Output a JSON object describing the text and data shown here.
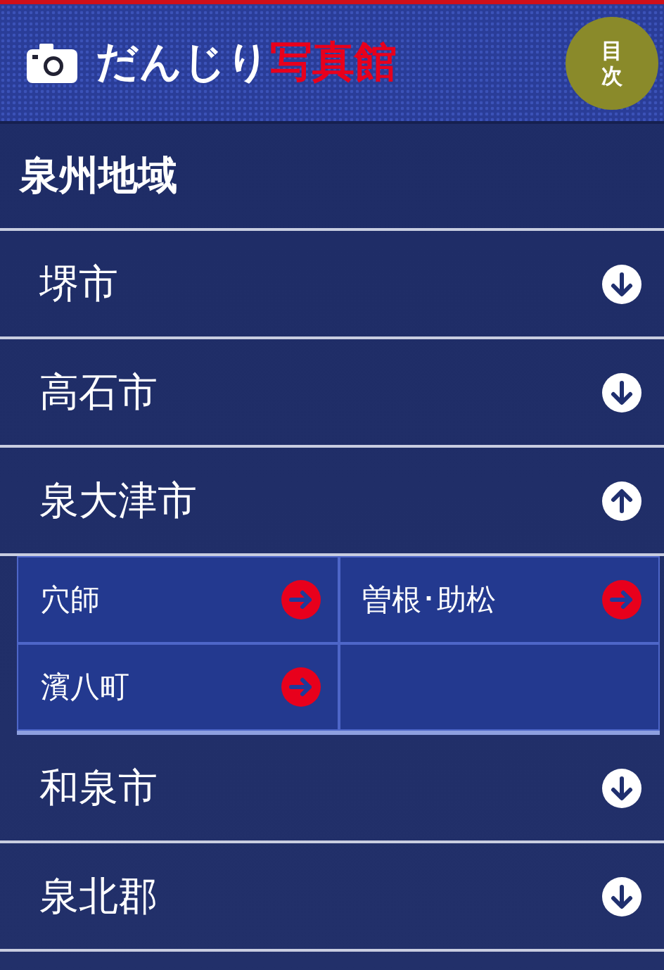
{
  "header": {
    "title_part1": "だんじり",
    "title_part2": "写真館",
    "menu_button": {
      "line1": "目",
      "line2": "次"
    }
  },
  "section_title": "泉州地域",
  "cities": [
    {
      "name": "堺市",
      "expanded": false
    },
    {
      "name": "高石市",
      "expanded": false
    },
    {
      "name": "泉大津市",
      "expanded": true,
      "children": [
        {
          "name": "穴師"
        },
        {
          "name": "曽根･助松"
        },
        {
          "name": "濱八町"
        }
      ]
    },
    {
      "name": "和泉市",
      "expanded": false
    },
    {
      "name": "泉北郡",
      "expanded": false
    }
  ]
}
